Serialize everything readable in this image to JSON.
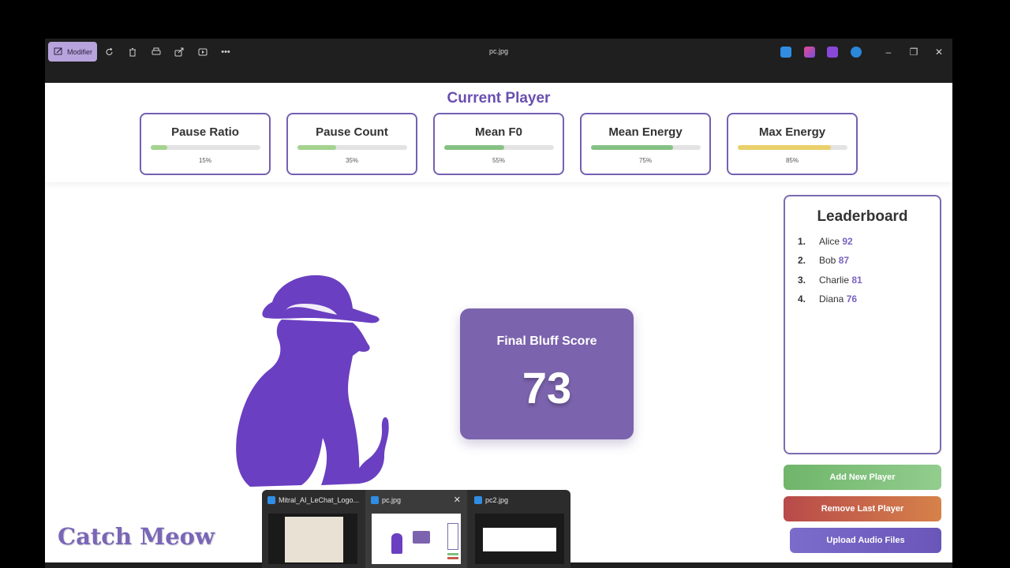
{
  "window": {
    "file_title": "pc.jpg",
    "modifier_label": "Modifier",
    "toolbar_icons": [
      "rotate-icon",
      "delete-icon",
      "print-icon",
      "share-icon",
      "slideshow-icon",
      "more-icon"
    ],
    "app_icons": [
      "photos-icon",
      "copilot-icon",
      "clipchamp-icon",
      "onedrive-icon"
    ],
    "controls": [
      "minimize-icon",
      "restore-icon",
      "close-icon"
    ]
  },
  "current_player": {
    "title": "Current Player",
    "metrics": [
      {
        "name": "Pause Ratio",
        "value_label": "15%",
        "value": 0.15,
        "color": "#a4d38f"
      },
      {
        "name": "Pause Count",
        "value_label": "35%",
        "value": 0.35,
        "color": "#a4d38f"
      },
      {
        "name": "Mean F0",
        "value_label": "55%",
        "value": 0.55,
        "color": "#86c184"
      },
      {
        "name": "Mean Energy",
        "value_label": "75%",
        "value": 0.75,
        "color": "#86c184"
      },
      {
        "name": "Max Energy",
        "value_label": "85%",
        "value": 0.85,
        "color": "#e9d06a"
      }
    ]
  },
  "score": {
    "label": "Final Bluff Score",
    "value": "73"
  },
  "leaderboard": {
    "title": "Leaderboard",
    "entries": [
      {
        "rank": "1.",
        "name": "Alice",
        "score": "92"
      },
      {
        "rank": "2.",
        "name": "Bob",
        "score": "87"
      },
      {
        "rank": "3.",
        "name": "Charlie",
        "score": "81"
      },
      {
        "rank": "4.",
        "name": "Diana",
        "score": "76"
      }
    ]
  },
  "actions": {
    "add": "Add New Player",
    "remove": "Remove Last Player",
    "upload": "Upload Audio Files"
  },
  "brand": "Catch Meow",
  "taskbar_previews": [
    {
      "label": "Mitral_AI_LeChat_Logo..."
    },
    {
      "label": "pc.jpg"
    },
    {
      "label": "pc2.jpg"
    }
  ],
  "colors": {
    "accent": "#7b63ad",
    "brand": "#7a66b8",
    "cat": "#6a3fc1"
  }
}
